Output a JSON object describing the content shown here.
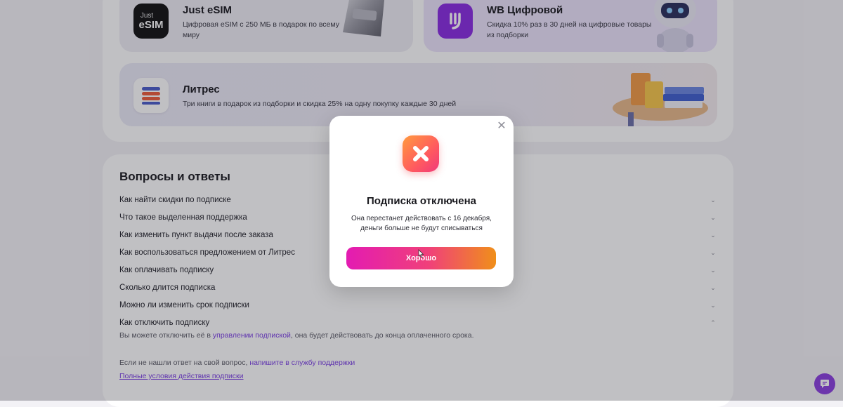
{
  "cards": {
    "esim": {
      "logo_line1": "Just",
      "logo_line2": "eSIM",
      "title": "Just eSIM",
      "desc": "Цифровая eSIM с 250 МБ в подарок по всему миру"
    },
    "wb": {
      "title": "WB Цифровой",
      "desc": "Скидка 10% раз в 30 дней на цифровые товары из подборки"
    },
    "litres": {
      "title": "Литрес",
      "desc": "Три книги в подарок из подборки и скидка 25% на одну покупку каждые 30 дней"
    }
  },
  "faq": {
    "title": "Вопросы и ответы",
    "items": [
      {
        "q": "Как найти скидки по подписке"
      },
      {
        "q": "Что такое выделенная поддержка"
      },
      {
        "q": "Как изменить пункт выдачи после заказа"
      },
      {
        "q": "Как воспользоваться предложением от Литрес"
      },
      {
        "q": "Как оплачивать подписку"
      },
      {
        "q": "Сколько длится подписка"
      },
      {
        "q": "Можно ли изменить срок подписки"
      },
      {
        "q": "Как отключить подписку"
      }
    ],
    "answer_prefix": "Вы можете отключить её в ",
    "answer_link": "управлении подпиской",
    "answer_suffix": ", она будет действовать до конца оплаченного срока.",
    "footer_prefix": "Если не нашли ответ на свой вопрос, ",
    "footer_link": "напишите в службу поддержки",
    "terms_link": "Полные условия действия подписки"
  },
  "modal": {
    "title": "Подписка отключена",
    "text": "Она перестанет действовать с 16 декабря, деньги больше не будут списываться",
    "button": "Хорошо"
  },
  "colors": {
    "accent": "#7b3fe4",
    "button_gradient": [
      "#e31bb2",
      "#f0407a",
      "#f08f1a"
    ],
    "modal_icon_gradient": [
      "#ff9a3d",
      "#ff5a5f",
      "#f03a7a"
    ]
  },
  "icons": {
    "modal_icon": "cross-icon",
    "close": "close-icon",
    "chevron": "chevron-down-icon",
    "chat": "chat-icon"
  }
}
